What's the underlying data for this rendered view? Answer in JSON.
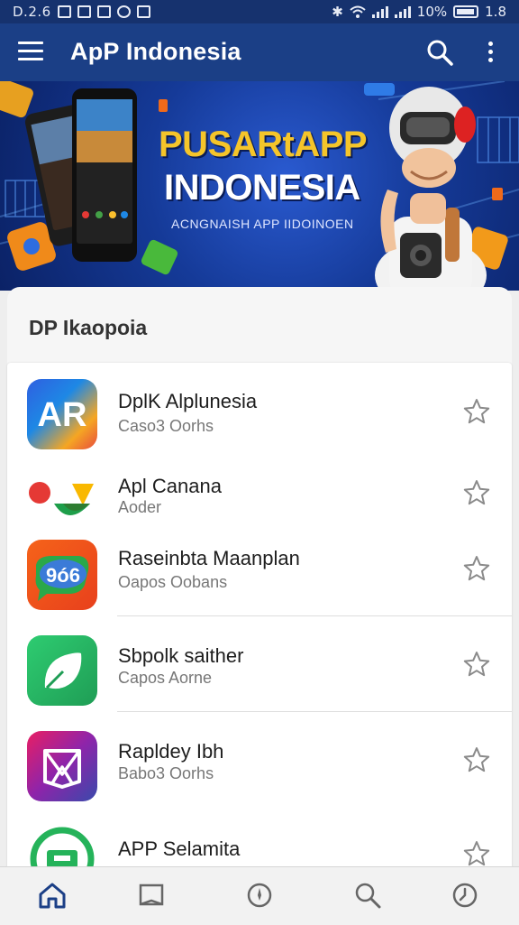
{
  "status_bar": {
    "time": "D.2.6",
    "battery": "10%",
    "clock_right": "1.8"
  },
  "app_bar": {
    "title": "ApP Indonesia",
    "menu_icon": "hamburger-menu-icon",
    "search_icon": "search-icon",
    "more_icon": "more-vert-icon"
  },
  "banner": {
    "title": "PUSARtAPP",
    "subtitle": "INDONESIA",
    "tagline": "ACNGNAISH APP IIDOINOEN"
  },
  "section": {
    "title": "DP Ikaopoia"
  },
  "apps": [
    {
      "name": "DplK Alplunesia",
      "sub": "Caso3 Oorhs",
      "icon": "ar-app-icon",
      "starred": false
    },
    {
      "name": "Apl Canana",
      "sub": "Aoder",
      "icon": "dots-app-icon",
      "starred": false
    },
    {
      "name": "Raseinbta Maanplan",
      "sub": "Oapos Oobans",
      "icon": "chat-app-icon",
      "starred": false
    },
    {
      "name": "Sbpolk saither",
      "sub": "Capos Aorne",
      "icon": "leaf-app-icon",
      "starred": false
    },
    {
      "name": "Rapldey Ibh",
      "sub": "Babo3 Oorhs",
      "icon": "gem-app-icon",
      "starred": false
    },
    {
      "name": "APP Selamita",
      "sub": "",
      "icon": "whatsapp-app-icon",
      "starred": false
    }
  ],
  "bottom_nav": {
    "items": [
      "home-icon",
      "bookmark-icon",
      "compass-icon",
      "search-icon",
      "clock-icon"
    ],
    "active_color": "#1b3f86",
    "inactive_color": "#666666"
  },
  "colors": {
    "app_bar": "#1b3f86",
    "status_bar": "#16326e",
    "banner_title": "#f5c52a"
  }
}
